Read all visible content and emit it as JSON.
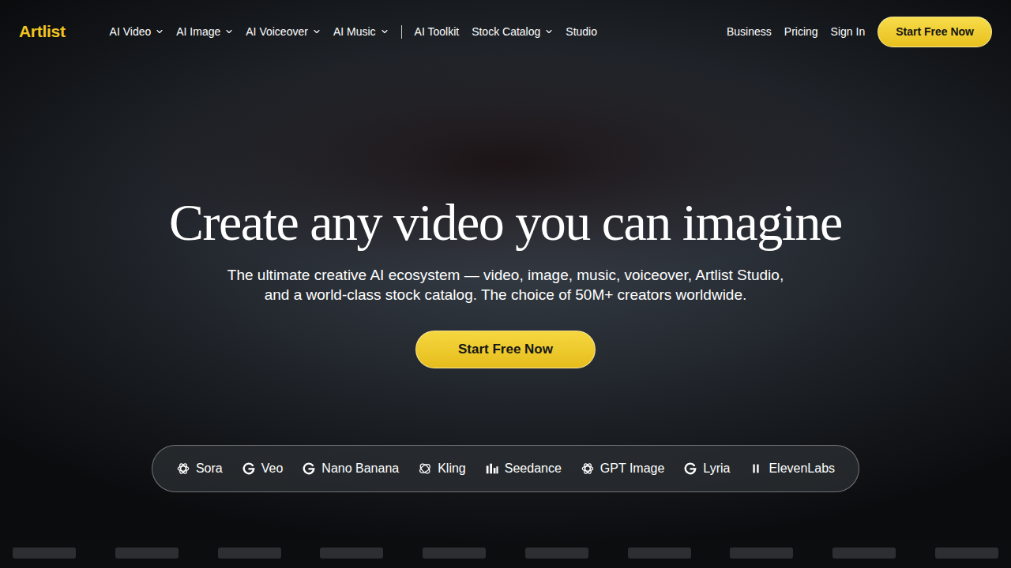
{
  "header": {
    "logo": "Artlist",
    "menu_groups": [
      [
        {
          "label": "AI Video",
          "dropdown": true
        },
        {
          "label": "AI Image",
          "dropdown": true
        },
        {
          "label": "AI Voiceover",
          "dropdown": true
        },
        {
          "label": "AI Music",
          "dropdown": true
        }
      ],
      [
        {
          "label": "AI Toolkit",
          "dropdown": false
        },
        {
          "label": "Stock Catalog",
          "dropdown": true
        },
        {
          "label": "Studio",
          "dropdown": false
        }
      ]
    ],
    "right_links": [
      "Business",
      "Pricing",
      "Sign In"
    ],
    "cta": "Start Free Now"
  },
  "hero": {
    "title": "Create any video you can imagine",
    "subtitle_lines": [
      "The ultimate creative AI ecosystem — video, image, music, voiceover, Artlist Studio,",
      "and a world-class stock catalog. The choice of 50M+ creators worldwide."
    ],
    "button": "Start Free Now"
  },
  "models": [
    "Sora",
    "Veo",
    "Nano Banana",
    "Kling",
    "Seedance",
    "GPT Image",
    "Lyria",
    "ElevenLabs"
  ]
}
